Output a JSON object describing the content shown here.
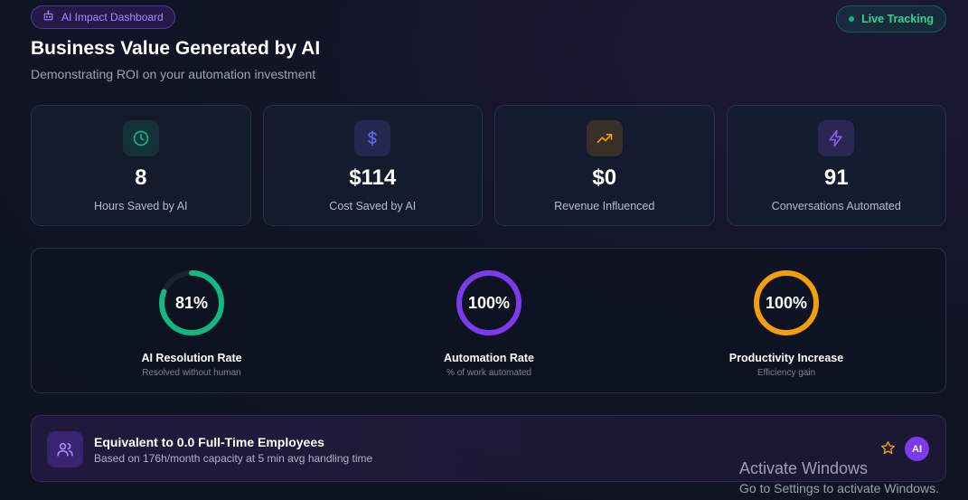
{
  "header": {
    "badge_label": "AI Impact Dashboard",
    "live_label": "Live Tracking",
    "title": "Business Value Generated by AI",
    "subtitle": "Demonstrating ROI on your automation investment"
  },
  "stats": [
    {
      "value": "8",
      "label": "Hours Saved by AI",
      "icon": "clock-icon",
      "color": "#10b981"
    },
    {
      "value": "$114",
      "label": "Cost Saved by AI",
      "icon": "dollar-icon",
      "color": "#6366f1"
    },
    {
      "value": "$0",
      "label": "Revenue Influenced",
      "icon": "trending-up-icon",
      "color": "#f59e0b"
    },
    {
      "value": "91",
      "label": "Conversations Automated",
      "icon": "lightning-icon",
      "color": "#8b5cf6"
    }
  ],
  "rings": [
    {
      "value_text": "81%",
      "percent": 81,
      "label": "AI Resolution Rate",
      "sub": "Resolved without human",
      "color": "#10b981"
    },
    {
      "value_text": "100%",
      "percent": 100,
      "label": "Automation Rate",
      "sub": "% of work automated",
      "color": "#7c3aed"
    },
    {
      "value_text": "100%",
      "percent": 100,
      "label": "Productivity Increase",
      "sub": "Efficiency gain",
      "color": "#f59e0b"
    }
  ],
  "equivalent": {
    "title": "Equivalent to 0.0 Full-Time Employees",
    "subtitle": "Based on 176h/month capacity at 5 min avg handling time",
    "icon": "users-icon",
    "star_icon": "star-icon",
    "avatar_label": "AI"
  },
  "os_watermark": {
    "line1": "Activate Windows",
    "line2": "Go to Settings to activate Windows."
  }
}
